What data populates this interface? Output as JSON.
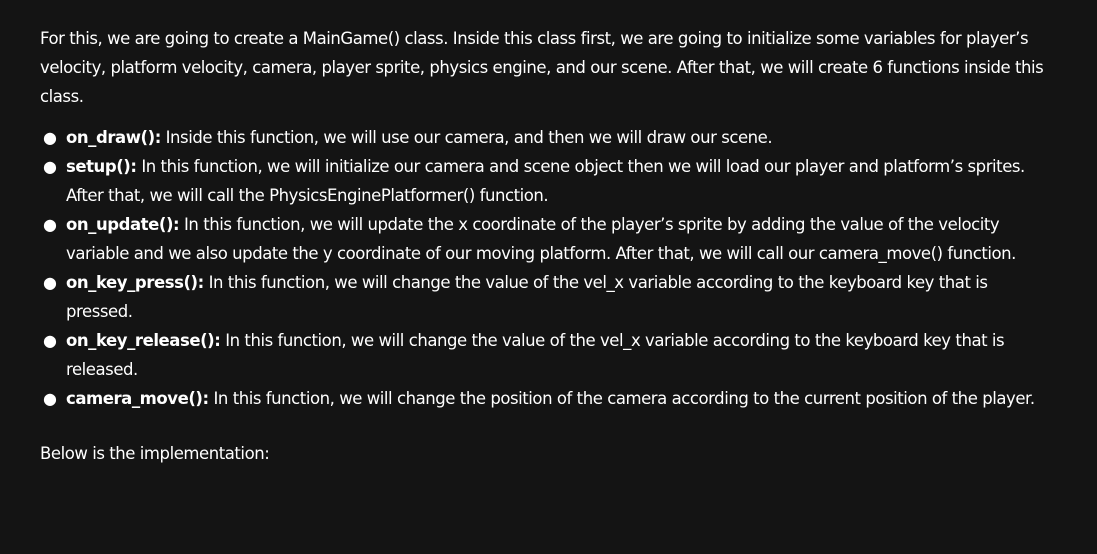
{
  "intro": "For this, we are going to create a MainGame() class. Inside this class first, we are going to initialize some variables for player’s velocity, platform velocity, camera, player sprite, physics engine, and our scene. After that, we will create 6 functions inside this class.",
  "functions": [
    {
      "name": "on_draw():",
      "description": " Inside this function, we will use our camera, and then we will draw our scene."
    },
    {
      "name": "setup():",
      "description": " In this function, we will initialize our camera and scene object then we will load our player and platform’s sprites. After that, we will call the  PhysicsEnginePlatformer() function."
    },
    {
      "name": "on_update():",
      "description": " In this function, we will update the x coordinate of the player’s sprite by adding the value of the velocity variable and we also update the y coordinate of our moving platform. After that, we will call our camera_move() function."
    },
    {
      "name": "on_key_press():",
      "description": " In this function, we will change the value of the vel_x  variable according to the keyboard key that is pressed."
    },
    {
      "name": "on_key_release():",
      "description": " In this function, we will change the value of the vel_x variable according to the keyboard key that is released."
    },
    {
      "name": "camera_move():",
      "description": " In this function, we will change the position of the camera according to the current position of the player."
    }
  ],
  "outro": "Below is the implementation:"
}
